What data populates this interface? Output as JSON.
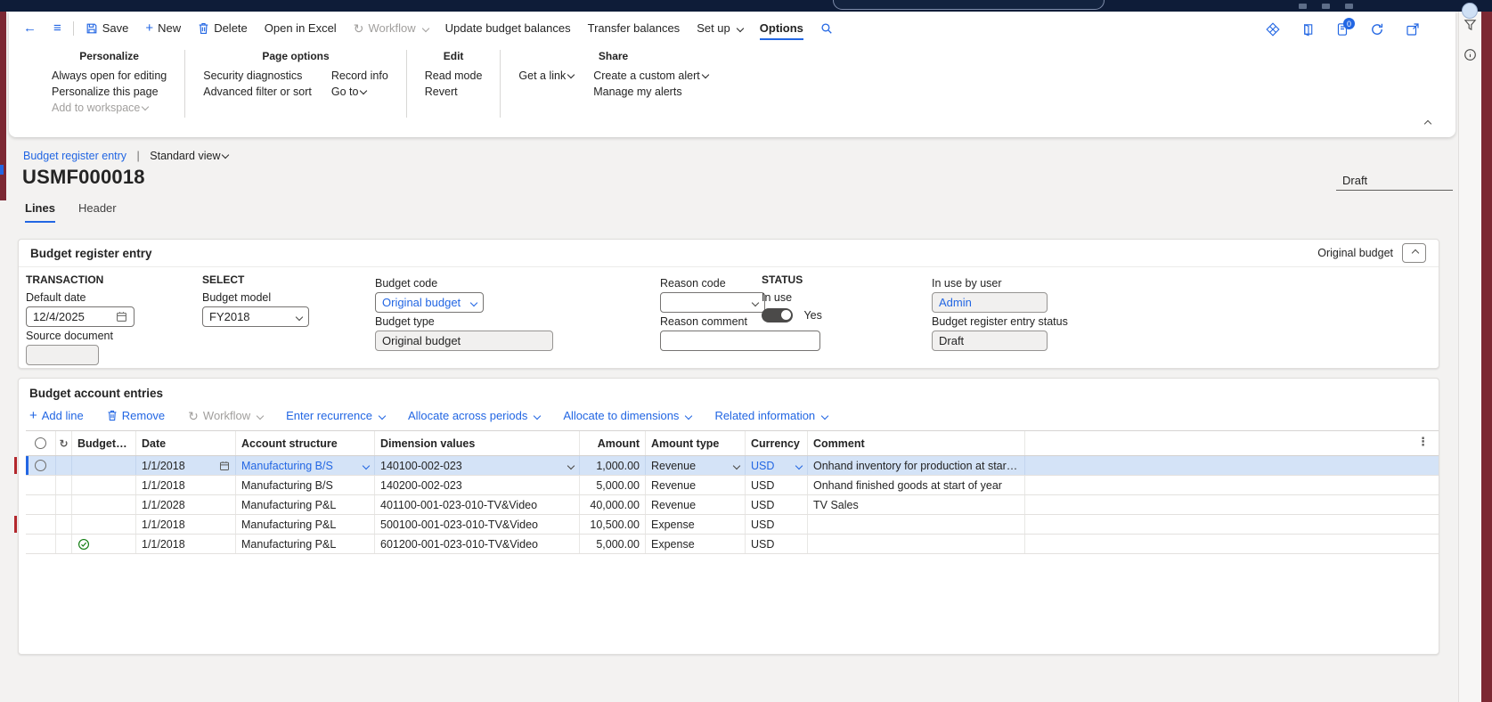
{
  "action_pane": {
    "save": "Save",
    "new": "New",
    "delete": "Delete",
    "open_in_excel": "Open in Excel",
    "workflow": "Workflow",
    "update_budget_balances": "Update budget balances",
    "transfer_balances": "Transfer balances",
    "set_up": "Set up",
    "options": "Options",
    "attachments_badge": "0"
  },
  "ribbon": {
    "personalize": {
      "title": "Personalize",
      "items": [
        "Always open for editing",
        "Personalize this page",
        "Add to workspace"
      ]
    },
    "page_options": {
      "title": "Page options",
      "col1": [
        "Security diagnostics",
        "Advanced filter or sort"
      ],
      "col2": [
        "Record info",
        "Go to"
      ]
    },
    "edit": {
      "title": "Edit",
      "items": [
        "Read mode",
        "Revert"
      ]
    },
    "share": {
      "title": "Share",
      "get_link": "Get a link",
      "items": [
        "Create a custom alert",
        "Manage my alerts"
      ]
    }
  },
  "breadcrumb": {
    "page": "Budget register entry",
    "separator": "|",
    "view": "Standard view"
  },
  "record": {
    "id": "USMF000018",
    "status": "Draft"
  },
  "tabs": {
    "lines": "Lines",
    "header": "Header"
  },
  "entry_section": {
    "title": "Budget register entry",
    "fasttab_summary": "Original budget",
    "transaction_group": "TRANSACTION",
    "select_group": "SELECT",
    "status_group": "STATUS",
    "fields": {
      "default_date": {
        "label": "Default date",
        "value": "12/4/2025"
      },
      "source_document": {
        "label": "Source document",
        "value": ""
      },
      "budget_model": {
        "label": "Budget model",
        "value": "FY2018"
      },
      "budget_code": {
        "label": "Budget code",
        "value": "Original budget"
      },
      "budget_type": {
        "label": "Budget type",
        "value": "Original budget"
      },
      "reason_code": {
        "label": "Reason code",
        "value": ""
      },
      "reason_comment": {
        "label": "Reason comment",
        "value": ""
      },
      "in_use": {
        "label": "In use",
        "value": "Yes"
      },
      "in_use_by_user": {
        "label": "In use by user",
        "value": "Admin"
      },
      "entry_status": {
        "label": "Budget register entry status",
        "value": "Draft"
      }
    }
  },
  "lines_section": {
    "title": "Budget account entries",
    "toolbar": {
      "add_line": "Add line",
      "remove": "Remove",
      "workflow": "Workflow",
      "enter_recurrence": "Enter recurrence",
      "allocate_across_periods": "Allocate across periods",
      "allocate_to_dimensions": "Allocate to dimensions",
      "related_information": "Related information"
    },
    "grid": {
      "columns": {
        "budget_check": "Budget ch...",
        "date": "Date",
        "account_structure": "Account structure",
        "dimension_values": "Dimension values",
        "amount": "Amount",
        "amount_type": "Amount type",
        "currency": "Currency",
        "comment": "Comment"
      },
      "rows": [
        {
          "selected": true,
          "edit_marker": true,
          "budget_check": "",
          "date": "1/1/2018",
          "account_structure": "Manufacturing B/S",
          "dimension_values": "140100-002-023",
          "amount": "1,000.00",
          "amount_type": "Revenue",
          "currency": "USD",
          "comment": "Onhand inventory for production at start of year"
        },
        {
          "selected": false,
          "edit_marker": false,
          "budget_check": "",
          "date": "1/1/2018",
          "account_structure": "Manufacturing B/S",
          "dimension_values": "140200-002-023",
          "amount": "5,000.00",
          "amount_type": "Revenue",
          "currency": "USD",
          "comment": "Onhand finished goods at start of year"
        },
        {
          "selected": false,
          "edit_marker": false,
          "budget_check": "",
          "date": "1/1/2028",
          "account_structure": "Manufacturing P&L",
          "dimension_values": "401100-001-023-010-TV&Video",
          "amount": "40,000.00",
          "amount_type": "Revenue",
          "currency": "USD",
          "comment": "TV Sales"
        },
        {
          "selected": false,
          "edit_marker": true,
          "budget_check": "",
          "date": "1/1/2018",
          "account_structure": "Manufacturing P&L",
          "dimension_values": "500100-001-023-010-TV&Video",
          "amount": "10,500.00",
          "amount_type": "Expense",
          "currency": "USD",
          "comment": ""
        },
        {
          "selected": false,
          "edit_marker": false,
          "budget_check": "passed",
          "date": "1/1/2018",
          "account_structure": "Manufacturing P&L",
          "dimension_values": "601200-001-023-010-TV&Video",
          "amount": "5,000.00",
          "amount_type": "Expense",
          "currency": "USD",
          "comment": ""
        }
      ]
    }
  },
  "colors": {
    "accent": "#2266e3",
    "selection_row": "#d4e3f7",
    "edge_strip": "#7c2833",
    "titlebar": "#0e1c38",
    "success_check": "#0f7b0f"
  }
}
